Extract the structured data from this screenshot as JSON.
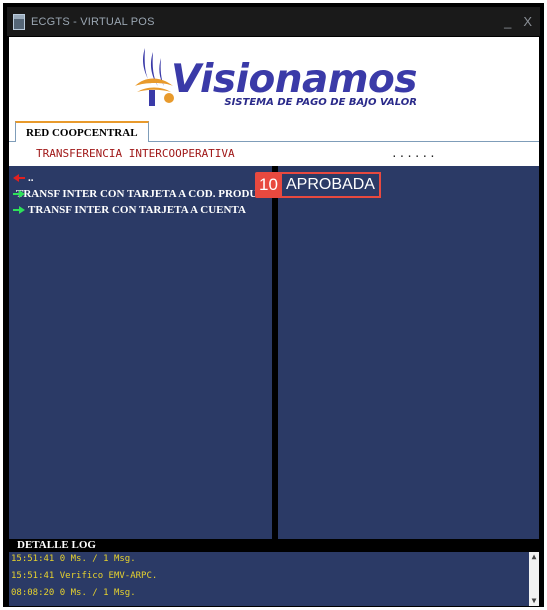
{
  "window": {
    "title": "ECGTS - VIRTUAL POS",
    "minimize_glyph": "_",
    "close_glyph": "X"
  },
  "logo": {
    "name": "Visionamos",
    "tagline": "SISTEMA DE PAGO DE BAJO VALOR",
    "colors": {
      "blue": "#3a3aa8",
      "orange": "#e89a2c"
    }
  },
  "tabs": [
    {
      "label": "RED COOPCENTRAL",
      "active": true
    }
  ],
  "operation": {
    "title": "TRANSFERENCIA INTERCOOPERATIVA",
    "dots": "......"
  },
  "menu": {
    "back_label": "..",
    "items": [
      {
        "label": "TRANSF INTER CON TARJETA A COD. PRODUCTO",
        "icon": "green-arrow-icon"
      },
      {
        "label": "TRANSF INTER CON TARJETA A CUENTA",
        "icon": "green-arrow-icon"
      }
    ]
  },
  "annotation": {
    "badge_number": "10",
    "status_text": "APROBADA",
    "color": "#e8493f"
  },
  "log": {
    "header": "DETALLE LOG",
    "lines": [
      "15:51:41 0 Ms. / 1 Msg.",
      "15:51:41 Verifico EMV-ARPC.",
      "08:08:20 0 Ms. / 1 Msg."
    ]
  },
  "colors": {
    "panel_bg": "#2b3a66",
    "title_red": "#a01818",
    "log_text": "#e6d22e"
  }
}
